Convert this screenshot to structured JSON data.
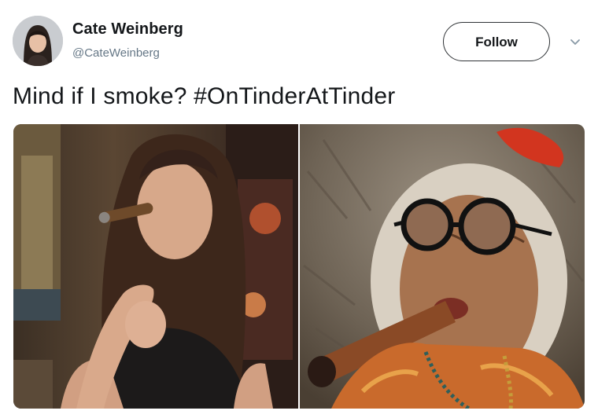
{
  "author": {
    "name": "Cate Weinberg",
    "handle": "@CateWeinberg"
  },
  "follow_label": "Follow",
  "tweet_text": "Mind if I smoke? #OnTinderAtTinder",
  "icons": {
    "caret": "chevron-down-icon"
  },
  "colors": {
    "text": "#14171a",
    "secondary": "#657786",
    "border": "#2f3336"
  }
}
